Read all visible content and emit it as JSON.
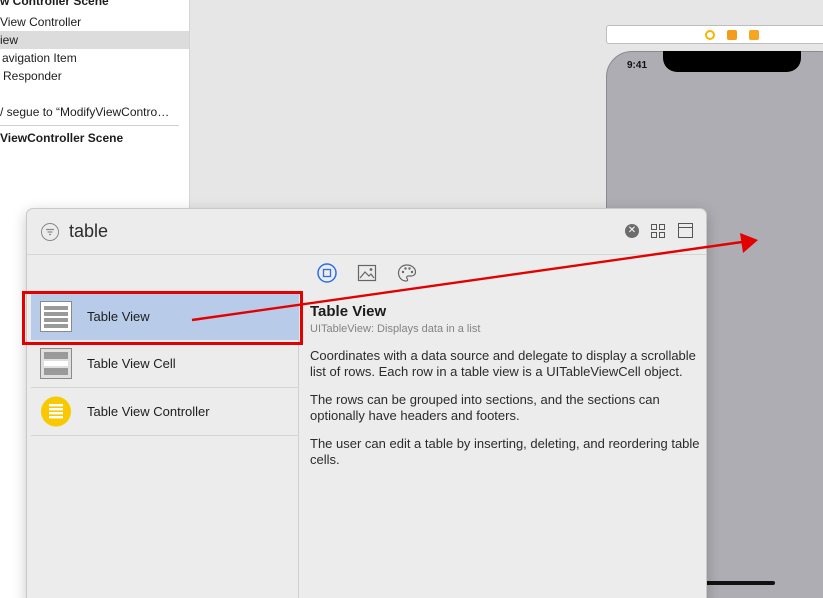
{
  "outline": {
    "rows": [
      {
        "label": "w Controller Scene",
        "selected": false,
        "bold": true
      },
      {
        "label": "View Controller",
        "selected": false,
        "bold": false
      },
      {
        "label": "iew",
        "selected": true,
        "bold": false
      },
      {
        "label": "avigation Item",
        "selected": false,
        "bold": false
      },
      {
        "label": "Responder",
        "selected": false,
        "bold": false
      },
      {
        "label": "/ segue to “ModifyViewContro…",
        "selected": false,
        "bold": false
      },
      {
        "label": "ViewController Scene",
        "selected": false,
        "bold": true
      }
    ]
  },
  "canvas": {
    "phone_time": "9:41",
    "scene_dock_icons": [
      "view-controller-icon",
      "first-responder-icon",
      "exit-icon"
    ],
    "dock_colors": [
      "#f7b500",
      "#f29b1d",
      "#f6a623"
    ]
  },
  "library": {
    "search": {
      "value": "table",
      "placeholder": "Filter"
    },
    "tabs": [
      {
        "name": "objects-tab-icon",
        "selected": true
      },
      {
        "name": "media-tab-icon",
        "selected": false
      },
      {
        "name": "colors-tab-icon",
        "selected": false
      }
    ],
    "items": [
      {
        "name": "Table View",
        "icon": "table-view-icon",
        "selected": true
      },
      {
        "name": "Table View Cell",
        "icon": "table-view-cell-icon",
        "selected": false
      },
      {
        "name": "Table View Controller",
        "icon": "table-view-controller-icon",
        "selected": false
      }
    ],
    "detail": {
      "title": "Table View",
      "subtitle": "UITableView: Displays data in a list",
      "paragraphs": [
        "Coordinates with a data source and delegate to display a scrollable list of rows. Each row in a table view is a UITableViewCell object.",
        "The rows can be grouped into sections, and the sections can optionally have headers and footers.",
        "The user can edit a table by inserting, deleting, and reordering table cells."
      ]
    }
  },
  "annotation": {
    "color": "#e30000",
    "kind": "drag-arrow"
  },
  "colors": {
    "accent": "#2f6fe0",
    "selection": "#b8cbe9"
  }
}
